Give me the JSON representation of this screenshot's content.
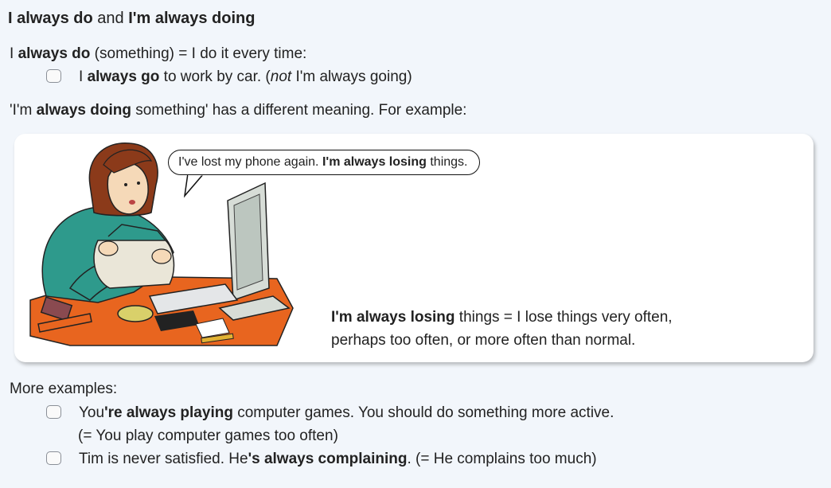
{
  "title": {
    "part1": "I always do",
    "part2": " and ",
    "part3": "I'm always doing"
  },
  "definition": {
    "pre": "I ",
    "bold": "always do",
    "rest": " (something) = I do it every time:"
  },
  "example1": {
    "pre": "I ",
    "bold": "always go",
    "rest": " to work by car.   (",
    "italic": "not",
    "post": " I'm always going)"
  },
  "intro": {
    "pre": "'I'm ",
    "bold": "always",
    "mid": " doing",
    "rest": " something' has a different meaning.  For example:"
  },
  "bubble": {
    "pre": "I've lost my phone again.  ",
    "bold": "I'm always losing",
    "post": " things."
  },
  "meaning": {
    "bold": "I'm always losing",
    "rest": " things = I lose things very often,",
    "line2": "perhaps too often, or more often than normal."
  },
  "more_label": "More examples:",
  "example2": {
    "pre": "You",
    "bold": "'re always playing",
    "rest": " computer games.  You should do something more active.",
    "line2": "(= You play computer games too often)"
  },
  "example3": {
    "pre": "Tim is never satisfied.  He",
    "bold": "'s always complaining",
    "rest": ".   (= He complains too much)"
  },
  "colors": {
    "background": "#f2f6fb",
    "panel": "#ffffff",
    "sweater": "#2e9a8c",
    "desk": "#e8651f"
  }
}
